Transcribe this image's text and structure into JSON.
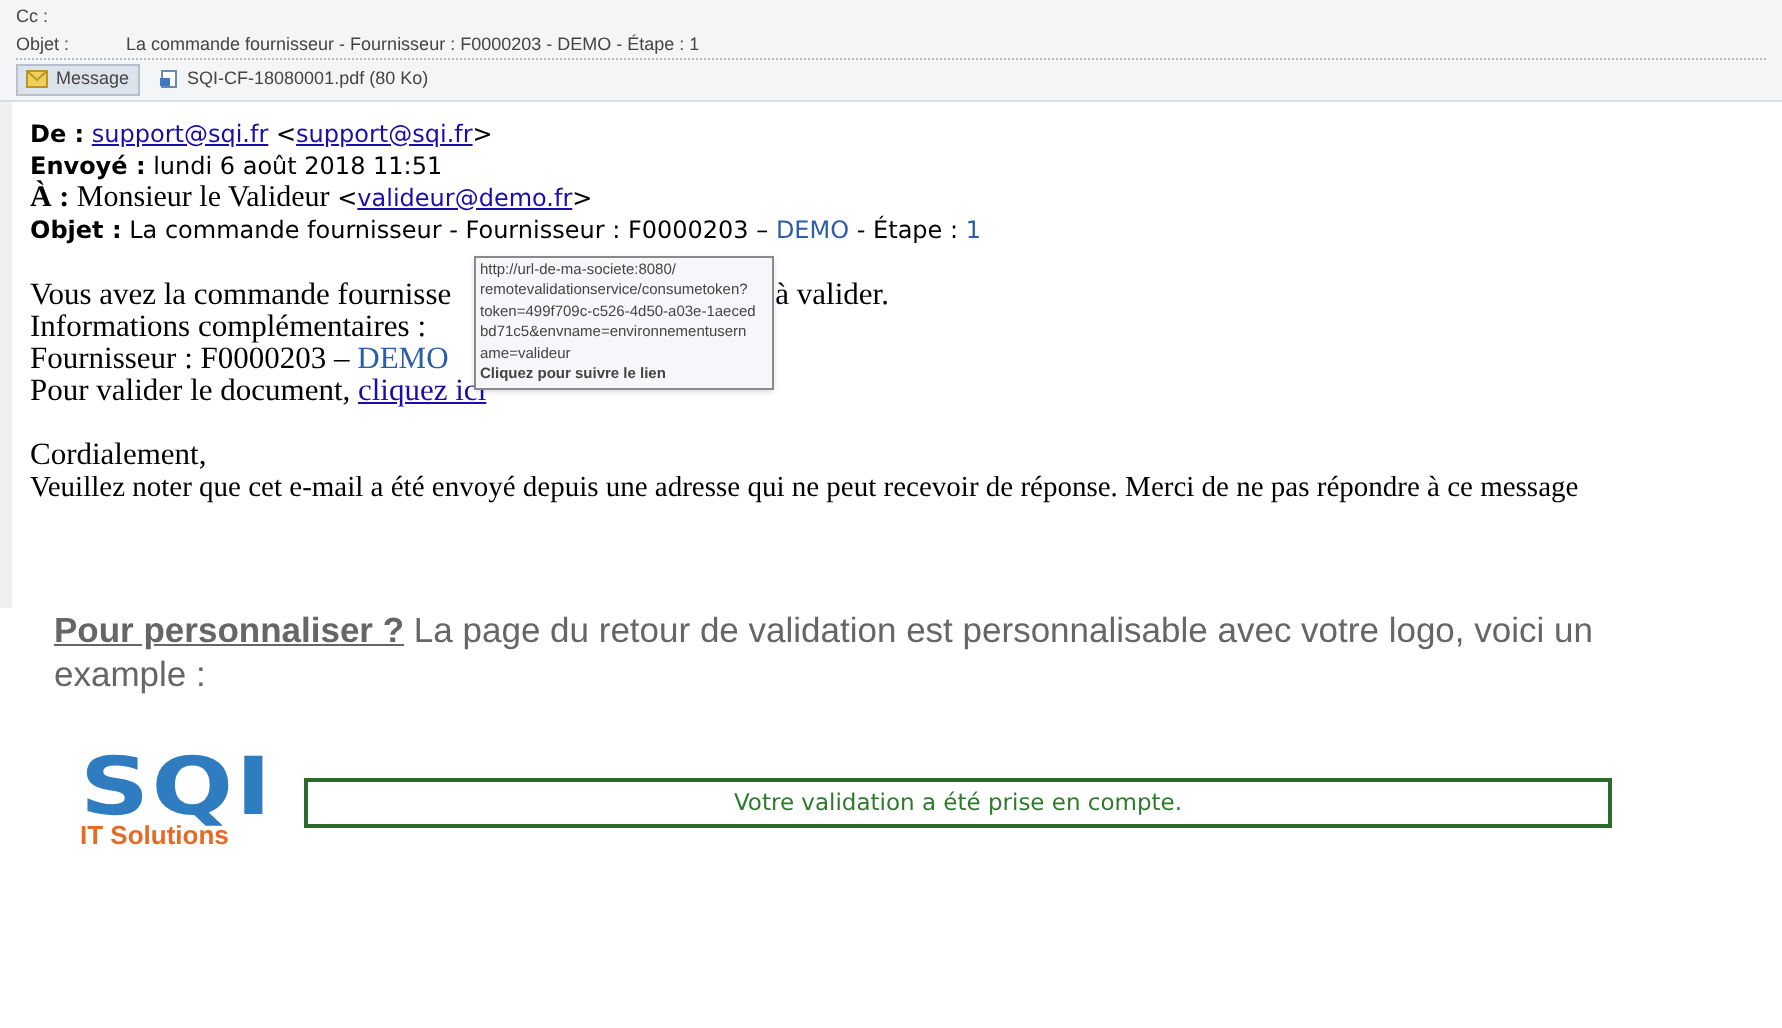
{
  "header": {
    "cc_label": "Cc :",
    "subject_label": "Objet :",
    "subject": "La commande fournisseur - Fournisseur : F0000203 - DEMO - Étape : 1",
    "tabs": [
      {
        "label": "Message",
        "selected": true
      },
      {
        "label": "SQI-CF-18080001.pdf (80 Ko)",
        "selected": false
      }
    ]
  },
  "email": {
    "from_open": "<",
    "from_close": ">",
    "to_open": "<",
    "to_close": ">",
    "from_label": "De :",
    "from_link": "support@sqi.fr",
    "from_addr": "support@sqi.fr",
    "sent_label": "Envoyé :",
    "sent": "lundi 6 août 2018 11:51",
    "to_label": "À :",
    "to_name": "Monsieur le Valideur",
    "to_addr": "valideur@demo.fr",
    "subject_label": "Objet :",
    "subject_a": "La commande fournisseur - Fournisseur : F0000203 –",
    "subject_demo": "DEMO",
    "subject_b": "- Étape :",
    "subject_step": "1",
    "line1_a": "Vous avez la commande fournisse",
    "line1_b": "à valider.",
    "line2": "Informations complémentaires :",
    "line3_a": "Fournisseur : F0000203 –",
    "line3_demo": "DEMO",
    "line4": "Pour valider le document,",
    "line4_link": "cliquez ici",
    "closing": "Cordialement,",
    "notice": "Veuillez noter que cet e-mail a été envoyé depuis une adresse qui ne peut recevoir de réponse. Merci de ne pas répondre à ce message"
  },
  "tooltip": {
    "lines": [
      "http://url-de-ma-societe:8080/",
      "remotevalidationservice/consumetoken?",
      "token=499f709c-c526-4d50-a03e-1aeced",
      "bd71c5&envname=environnementusern",
      "ame=valideur"
    ],
    "action": "Cliquez pour suivre le lien"
  },
  "custom": {
    "link": "Pour personnaliser ?",
    "text": "La page du retour de validation est personnalisable avec votre logo, voici un example :",
    "logo_top": "SQI",
    "logo_sub": "IT Solutions",
    "confirmation": "Votre validation a été prise en compte."
  }
}
